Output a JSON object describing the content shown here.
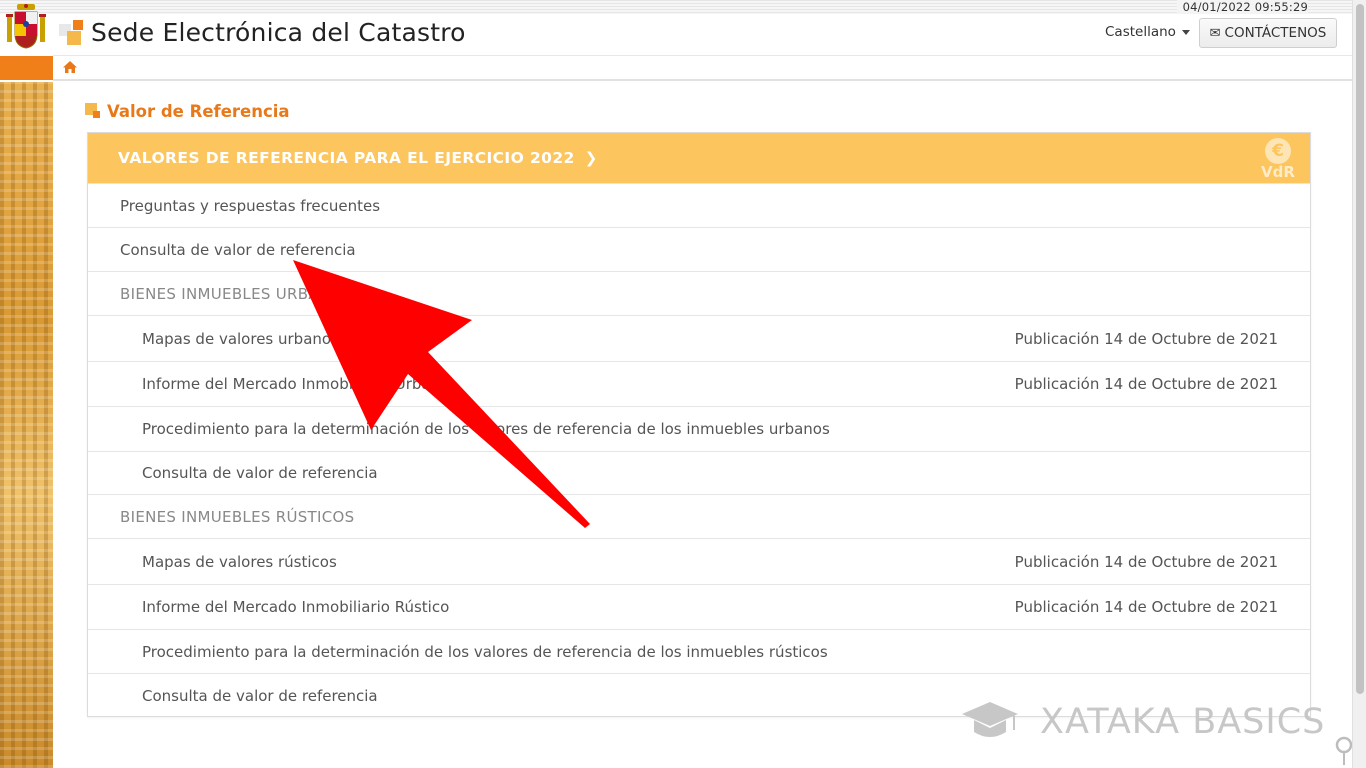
{
  "topbar": {
    "datetime": "04/01/2022  09:55:29"
  },
  "header": {
    "site_title": "Sede Electrónica del Catastro",
    "language": "Castellano",
    "contact_label": "CONTÁCTENOS"
  },
  "section": {
    "title": "Valor de Referencia"
  },
  "panel": {
    "header_label": "VALORES DE REFERENCIA PARA EL EJERCICIO 2022",
    "badge_symbol": "€",
    "badge_text": "VdR",
    "rows": [
      {
        "label": "Preguntas y respuestas frecuentes",
        "date": ""
      },
      {
        "label": "Consulta de valor de referencia",
        "date": ""
      },
      {
        "label": "BIENES INMUEBLES URBANOS",
        "date": ""
      },
      {
        "label": "Mapas de valores urbanos",
        "date": "Publicación 14 de Octubre de 2021"
      },
      {
        "label": "Informe del Mercado Inmobiliario Urbano",
        "date": "Publicación 14 de Octubre de 2021"
      },
      {
        "label": "Procedimiento para la determinación de los valores de referencia de los inmuebles urbanos",
        "date": ""
      },
      {
        "label": "Consulta de valor de referencia",
        "date": ""
      },
      {
        "label": "BIENES INMUEBLES RÚSTICOS",
        "date": ""
      },
      {
        "label": "Mapas de valores rústicos",
        "date": "Publicación 14 de Octubre de 2021"
      },
      {
        "label": "Informe del Mercado Inmobiliario Rústico",
        "date": "Publicación 14 de Octubre de 2021"
      },
      {
        "label": "Procedimiento para la determinación de los valores de referencia de los inmuebles rústicos",
        "date": ""
      },
      {
        "label": "Consulta de valor de referencia",
        "date": ""
      }
    ]
  },
  "watermark": {
    "text": "XATAKA BASICS"
  },
  "colors": {
    "accent_orange": "#f07f1a",
    "panel_header": "#fcc55e",
    "title_orange": "#e8791a",
    "arrow_red": "#ff0000"
  }
}
